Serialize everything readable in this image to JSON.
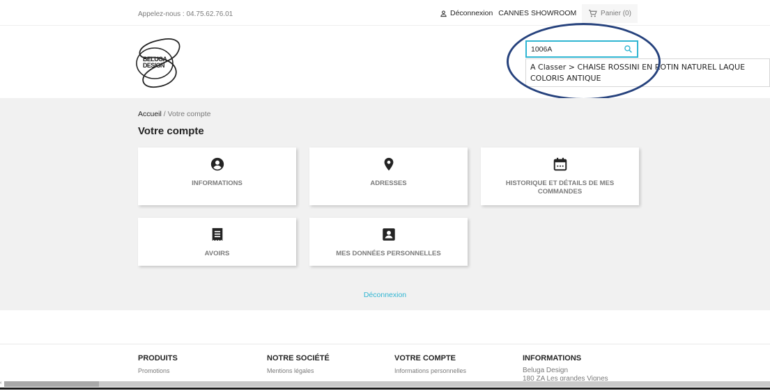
{
  "topbar": {
    "phone": "Appelez-nous : 04.75.62.76.01",
    "logout": "Déconnexion",
    "showroom": "CANNES SHOWROOM",
    "cart": "Panier (0)"
  },
  "header": {
    "logo_line1": "BELUGA",
    "logo_line2": "DESIGN",
    "search_value": "1006A",
    "suggestion_line1": "A Classer > CHAISE ROSSINI EN ROTIN NATUREL LAQUE",
    "suggestion_line2": "COLORIS ANTIQUE"
  },
  "breadcrumb": {
    "home": "Accueil",
    "separator": "/",
    "current": "Votre compte"
  },
  "page_title": "Votre compte",
  "cards": {
    "informations": "INFORMATIONS",
    "adresses": "ADRESSES",
    "historique_1": "HISTORIQUE ET DÉTAILS DE MES",
    "historique_2": "COMMANDES",
    "avoirs": "AVOIRS",
    "donnees": "MES DONNÉES PERSONNELLES"
  },
  "logout_link": "Déconnexion",
  "footer": {
    "col1_title": "PRODUITS",
    "col1_item": "Promotions",
    "col2_title": "NOTRE SOCIÉTÉ",
    "col2_item": "Mentions légales",
    "col3_title": "VOTRE COMPTE",
    "col3_item": "Informations personnelles",
    "col4_title": "INFORMATIONS",
    "col4_line1": "Beluga Design",
    "col4_line2": "180 ZA Les grandes Vignes"
  },
  "colors": {
    "accent": "#2fb5d2",
    "annotation_circle": "#26427d",
    "text": "#232323",
    "muted": "#7a7a7a",
    "background": "#f1f1f1"
  },
  "icons": {
    "user": "user-outline-icon",
    "cart": "shopping-cart-icon",
    "search": "search-icon",
    "informations": "account-circle-icon",
    "adresses": "location-pin-icon",
    "historique": "calendar-icon",
    "avoirs": "receipt-icon",
    "donnees": "id-card-icon"
  }
}
